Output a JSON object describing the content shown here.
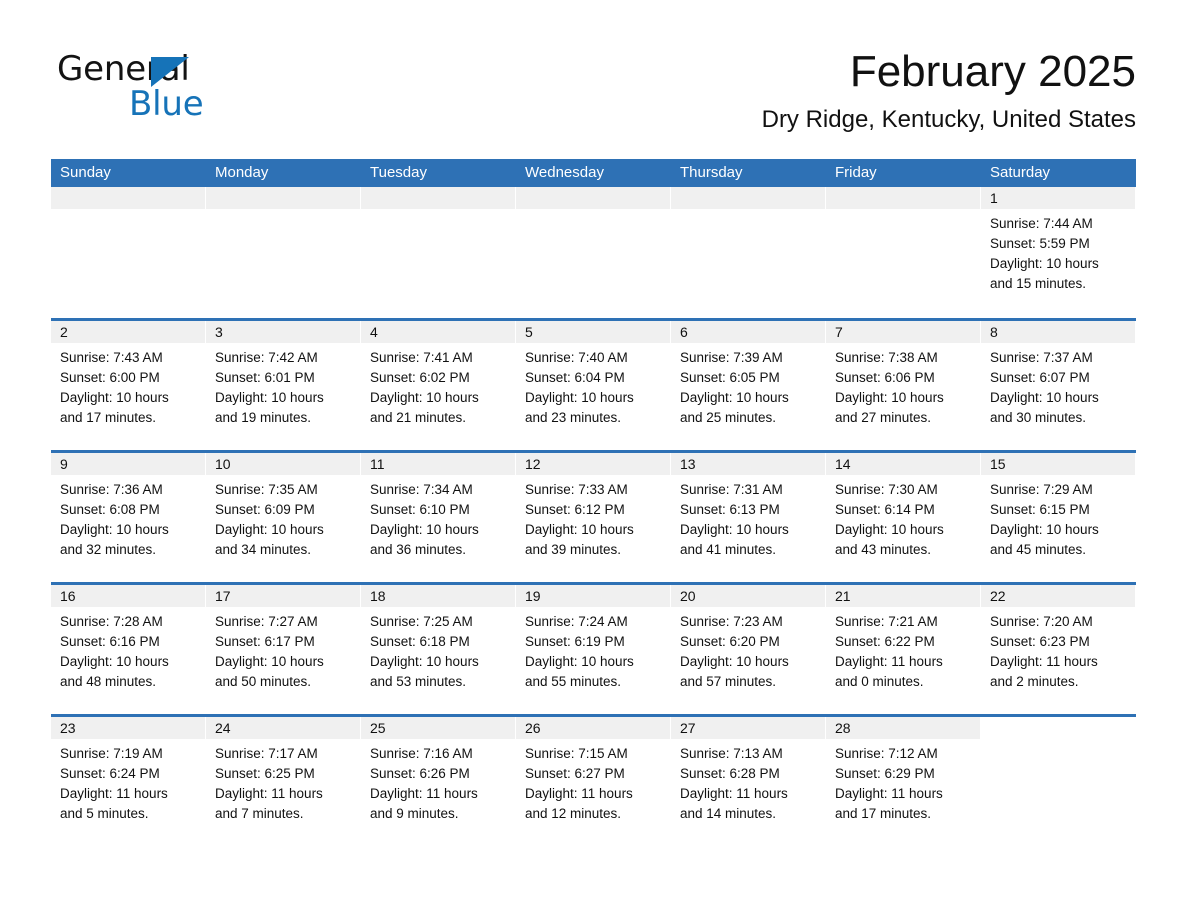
{
  "brand": {
    "word_one": "General",
    "word_two": "Blue",
    "triangle_color": "#1673b8",
    "icon": "general-blue-logo"
  },
  "header": {
    "month_title": "February 2025",
    "location": "Dry Ridge, Kentucky, United States"
  },
  "calendar": {
    "accent_color": "#2e71b5",
    "daynum_strip_color": "#f0f0f0",
    "weekdays": [
      "Sunday",
      "Monday",
      "Tuesday",
      "Wednesday",
      "Thursday",
      "Friday",
      "Saturday"
    ],
    "weeks": [
      [
        {
          "day": "",
          "sunrise": "",
          "sunset": "",
          "daylight_line1": "",
          "daylight_line2": "",
          "empty": true
        },
        {
          "day": "",
          "sunrise": "",
          "sunset": "",
          "daylight_line1": "",
          "daylight_line2": "",
          "empty": true
        },
        {
          "day": "",
          "sunrise": "",
          "sunset": "",
          "daylight_line1": "",
          "daylight_line2": "",
          "empty": true
        },
        {
          "day": "",
          "sunrise": "",
          "sunset": "",
          "daylight_line1": "",
          "daylight_line2": "",
          "empty": true
        },
        {
          "day": "",
          "sunrise": "",
          "sunset": "",
          "daylight_line1": "",
          "daylight_line2": "",
          "empty": true
        },
        {
          "day": "",
          "sunrise": "",
          "sunset": "",
          "daylight_line1": "",
          "daylight_line2": "",
          "empty": true
        },
        {
          "day": "1",
          "sunrise": "Sunrise: 7:44 AM",
          "sunset": "Sunset: 5:59 PM",
          "daylight_line1": "Daylight: 10 hours",
          "daylight_line2": "and 15 minutes.",
          "empty": false
        }
      ],
      [
        {
          "day": "2",
          "sunrise": "Sunrise: 7:43 AM",
          "sunset": "Sunset: 6:00 PM",
          "daylight_line1": "Daylight: 10 hours",
          "daylight_line2": "and 17 minutes.",
          "empty": false
        },
        {
          "day": "3",
          "sunrise": "Sunrise: 7:42 AM",
          "sunset": "Sunset: 6:01 PM",
          "daylight_line1": "Daylight: 10 hours",
          "daylight_line2": "and 19 minutes.",
          "empty": false
        },
        {
          "day": "4",
          "sunrise": "Sunrise: 7:41 AM",
          "sunset": "Sunset: 6:02 PM",
          "daylight_line1": "Daylight: 10 hours",
          "daylight_line2": "and 21 minutes.",
          "empty": false
        },
        {
          "day": "5",
          "sunrise": "Sunrise: 7:40 AM",
          "sunset": "Sunset: 6:04 PM",
          "daylight_line1": "Daylight: 10 hours",
          "daylight_line2": "and 23 minutes.",
          "empty": false
        },
        {
          "day": "6",
          "sunrise": "Sunrise: 7:39 AM",
          "sunset": "Sunset: 6:05 PM",
          "daylight_line1": "Daylight: 10 hours",
          "daylight_line2": "and 25 minutes.",
          "empty": false
        },
        {
          "day": "7",
          "sunrise": "Sunrise: 7:38 AM",
          "sunset": "Sunset: 6:06 PM",
          "daylight_line1": "Daylight: 10 hours",
          "daylight_line2": "and 27 minutes.",
          "empty": false
        },
        {
          "day": "8",
          "sunrise": "Sunrise: 7:37 AM",
          "sunset": "Sunset: 6:07 PM",
          "daylight_line1": "Daylight: 10 hours",
          "daylight_line2": "and 30 minutes.",
          "empty": false
        }
      ],
      [
        {
          "day": "9",
          "sunrise": "Sunrise: 7:36 AM",
          "sunset": "Sunset: 6:08 PM",
          "daylight_line1": "Daylight: 10 hours",
          "daylight_line2": "and 32 minutes.",
          "empty": false
        },
        {
          "day": "10",
          "sunrise": "Sunrise: 7:35 AM",
          "sunset": "Sunset: 6:09 PM",
          "daylight_line1": "Daylight: 10 hours",
          "daylight_line2": "and 34 minutes.",
          "empty": false
        },
        {
          "day": "11",
          "sunrise": "Sunrise: 7:34 AM",
          "sunset": "Sunset: 6:10 PM",
          "daylight_line1": "Daylight: 10 hours",
          "daylight_line2": "and 36 minutes.",
          "empty": false
        },
        {
          "day": "12",
          "sunrise": "Sunrise: 7:33 AM",
          "sunset": "Sunset: 6:12 PM",
          "daylight_line1": "Daylight: 10 hours",
          "daylight_line2": "and 39 minutes.",
          "empty": false
        },
        {
          "day": "13",
          "sunrise": "Sunrise: 7:31 AM",
          "sunset": "Sunset: 6:13 PM",
          "daylight_line1": "Daylight: 10 hours",
          "daylight_line2": "and 41 minutes.",
          "empty": false
        },
        {
          "day": "14",
          "sunrise": "Sunrise: 7:30 AM",
          "sunset": "Sunset: 6:14 PM",
          "daylight_line1": "Daylight: 10 hours",
          "daylight_line2": "and 43 minutes.",
          "empty": false
        },
        {
          "day": "15",
          "sunrise": "Sunrise: 7:29 AM",
          "sunset": "Sunset: 6:15 PM",
          "daylight_line1": "Daylight: 10 hours",
          "daylight_line2": "and 45 minutes.",
          "empty": false
        }
      ],
      [
        {
          "day": "16",
          "sunrise": "Sunrise: 7:28 AM",
          "sunset": "Sunset: 6:16 PM",
          "daylight_line1": "Daylight: 10 hours",
          "daylight_line2": "and 48 minutes.",
          "empty": false
        },
        {
          "day": "17",
          "sunrise": "Sunrise: 7:27 AM",
          "sunset": "Sunset: 6:17 PM",
          "daylight_line1": "Daylight: 10 hours",
          "daylight_line2": "and 50 minutes.",
          "empty": false
        },
        {
          "day": "18",
          "sunrise": "Sunrise: 7:25 AM",
          "sunset": "Sunset: 6:18 PM",
          "daylight_line1": "Daylight: 10 hours",
          "daylight_line2": "and 53 minutes.",
          "empty": false
        },
        {
          "day": "19",
          "sunrise": "Sunrise: 7:24 AM",
          "sunset": "Sunset: 6:19 PM",
          "daylight_line1": "Daylight: 10 hours",
          "daylight_line2": "and 55 minutes.",
          "empty": false
        },
        {
          "day": "20",
          "sunrise": "Sunrise: 7:23 AM",
          "sunset": "Sunset: 6:20 PM",
          "daylight_line1": "Daylight: 10 hours",
          "daylight_line2": "and 57 minutes.",
          "empty": false
        },
        {
          "day": "21",
          "sunrise": "Sunrise: 7:21 AM",
          "sunset": "Sunset: 6:22 PM",
          "daylight_line1": "Daylight: 11 hours",
          "daylight_line2": "and 0 minutes.",
          "empty": false
        },
        {
          "day": "22",
          "sunrise": "Sunrise: 7:20 AM",
          "sunset": "Sunset: 6:23 PM",
          "daylight_line1": "Daylight: 11 hours",
          "daylight_line2": "and 2 minutes.",
          "empty": false
        }
      ],
      [
        {
          "day": "23",
          "sunrise": "Sunrise: 7:19 AM",
          "sunset": "Sunset: 6:24 PM",
          "daylight_line1": "Daylight: 11 hours",
          "daylight_line2": "and 5 minutes.",
          "empty": false
        },
        {
          "day": "24",
          "sunrise": "Sunrise: 7:17 AM",
          "sunset": "Sunset: 6:25 PM",
          "daylight_line1": "Daylight: 11 hours",
          "daylight_line2": "and 7 minutes.",
          "empty": false
        },
        {
          "day": "25",
          "sunrise": "Sunrise: 7:16 AM",
          "sunset": "Sunset: 6:26 PM",
          "daylight_line1": "Daylight: 11 hours",
          "daylight_line2": "and 9 minutes.",
          "empty": false
        },
        {
          "day": "26",
          "sunrise": "Sunrise: 7:15 AM",
          "sunset": "Sunset: 6:27 PM",
          "daylight_line1": "Daylight: 11 hours",
          "daylight_line2": "and 12 minutes.",
          "empty": false
        },
        {
          "day": "27",
          "sunrise": "Sunrise: 7:13 AM",
          "sunset": "Sunset: 6:28 PM",
          "daylight_line1": "Daylight: 11 hours",
          "daylight_line2": "and 14 minutes.",
          "empty": false
        },
        {
          "day": "28",
          "sunrise": "Sunrise: 7:12 AM",
          "sunset": "Sunset: 6:29 PM",
          "daylight_line1": "Daylight: 11 hours",
          "daylight_line2": "and 17 minutes.",
          "empty": false
        },
        {
          "day": "",
          "sunrise": "",
          "sunset": "",
          "daylight_line1": "",
          "daylight_line2": "",
          "empty": true,
          "blank": true
        }
      ]
    ]
  }
}
